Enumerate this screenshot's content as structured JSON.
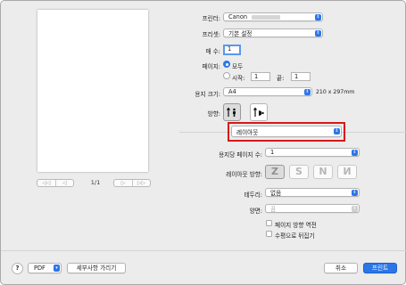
{
  "preview": {
    "page_indicator": "1/1",
    "pager_glyphs": {
      "first": "◁◁",
      "prev": "◁",
      "next": "▷",
      "last": "▷▷"
    }
  },
  "printer": {
    "label": "프린터:",
    "value": "Canon"
  },
  "presets": {
    "label": "프리셋:",
    "value": "기본 설정"
  },
  "copies": {
    "label": "매 수:",
    "value": "1"
  },
  "pages": {
    "label": "페이지:",
    "all": "모두",
    "from_label": "시작:",
    "from_value": "1",
    "to_label": "끝:",
    "to_value": "1"
  },
  "paper_size": {
    "label": "용지 크기:",
    "value": "A4",
    "dimensions": "210 x 297mm"
  },
  "orientation": {
    "label": "방향:",
    "selected": "portrait"
  },
  "section": {
    "value": "레이아웃"
  },
  "pages_per_sheet": {
    "label": "용지당 페이지 수:",
    "value": "1"
  },
  "layout_direction": {
    "label": "레이아웃 방향:",
    "options": [
      "Z",
      "S",
      "N",
      "N"
    ],
    "selected_index": 0
  },
  "border": {
    "label": "테두리:",
    "value": "없음"
  },
  "two_sided": {
    "label": "양면:",
    "value": "끔"
  },
  "reverse_orientation": {
    "label": "페이지 방향 역전",
    "checked": false
  },
  "flip_horizontally": {
    "label": "수평으로 뒤집기",
    "checked": false
  },
  "footer": {
    "help": "?",
    "pdf": "PDF",
    "show_details": "세부사항 가리기",
    "cancel": "취소",
    "print": "프린트"
  },
  "colors": {
    "accent": "#2c76e8",
    "highlight_box": "#d81818",
    "dialog_bg": "#ececec"
  }
}
